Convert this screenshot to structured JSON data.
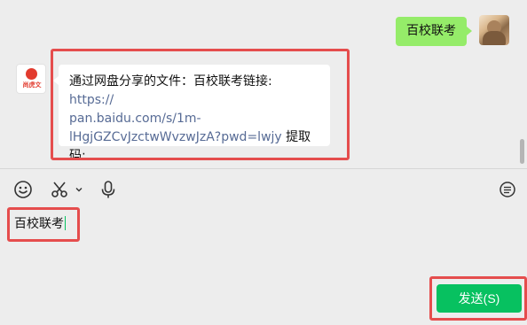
{
  "chat": {
    "outgoing_message": "百校联考",
    "incoming_message": {
      "prefix": "通过网盘分享的文件：百校联考链接: ",
      "link_line1": "https://",
      "link_line2": "pan.baidu.com/s/1m-",
      "link_line3": "lHgjGZCvJzctwWvzwJzA?pwd=lwjy",
      "suffix": " 提取码:",
      "code": "lwjy"
    },
    "other_avatar_label": "尚虎文"
  },
  "toolbar": {
    "emoji_icon": "emoji-icon",
    "screenshot_icon": "scissors-icon",
    "voice_icon": "microphone-icon",
    "history_icon": "chat-history-icon"
  },
  "composer": {
    "input_text": "百校联考"
  },
  "actions": {
    "send_label": "发送(S)"
  },
  "colors": {
    "accent": "#07c160",
    "outgoing_bubble": "#95ec69",
    "highlight_box": "#e54d4d",
    "link": "#576b95"
  }
}
